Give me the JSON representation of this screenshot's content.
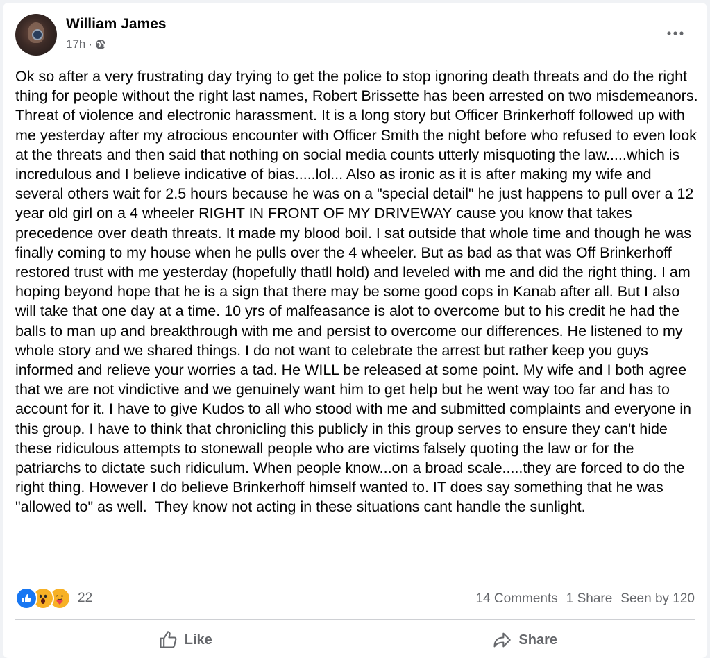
{
  "post": {
    "author": "William James",
    "time": "17h",
    "separator": "·",
    "privacy_icon": "globe-icon",
    "more_icon": "more-horizontal-icon",
    "body": "Ok so after a very frustrating day trying to get the police to stop ignoring death threats and do the right thing for people without the right last names, Robert Brissette has been arrested on two misdemeanors. Threat of violence and electronic harassment. It is a long story but Officer Brinkerhoff followed up with me yesterday after my atrocious encounter with Officer Smith the night before who refused to even look at the threats and then said that nothing on social media counts utterly misquoting the law.....which is incredulous and I believe indicative of bias.....lol... Also as ironic as it is after making my wife and several others wait for 2.5 hours because he was on a \"special detail\" he just happens to pull over a 12 year old girl on a 4 wheeler RIGHT IN FRONT OF MY DRIVEWAY cause you know that takes precedence over death threats. It made my blood boil. I sat outside that whole time and though he was finally coming to my house when he pulls over the 4 wheeler. But as bad as that was Off Brinkerhoff restored trust with me yesterday (hopefully thatll hold) and leveled with me and did the right thing. I am hoping beyond hope that he is a sign that there may be some good cops in Kanab after all. But I also will take that one day at a time. 10 yrs of malfeasance is alot to overcome but to his credit he had the balls to man up and breakthrough with me and persist to overcome our differences. He listened to my whole story and we shared things. I do not want to celebrate the arrest but rather keep you guys informed and relieve your worries a tad. He WILL be released at some point. My wife and I both agree that we are not vindictive and we genuinely want him to get help but he went way too far and has to account for it. I have to give Kudos to all who stood with me and submitted complaints and everyone in this group. I have to think that chronicling this publicly in this group serves to ensure they can't hide these ridiculous attempts to stonewall people who are victims falsely quoting the law or for the patriarchs to dictate such ridiculum. When people know...on a broad scale.....they are forced to do the right thing. However I do believe Brinkerhoff himself wanted to. IT does say something that he was \"allowed to\" as well.  They know not acting in these situations cant handle the sunlight."
  },
  "stats": {
    "reactions": [
      "like-reaction-icon",
      "wow-reaction-icon",
      "care-reaction-icon"
    ],
    "reaction_count": "22",
    "comments": "14 Comments",
    "shares": "1 Share",
    "seen_by": "Seen by 120"
  },
  "actions": {
    "like_label": "Like",
    "like_icon": "thumbs-up-icon",
    "share_label": "Share",
    "share_icon": "share-arrow-icon"
  },
  "colors": {
    "like_blue": "#1877f2",
    "reaction_yellow": "#f7b125",
    "secondary_text": "#65676b"
  }
}
